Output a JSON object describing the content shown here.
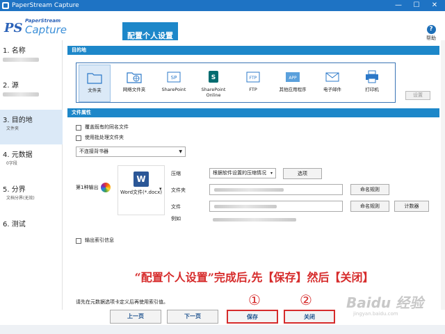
{
  "window": {
    "title": "PaperStream Capture",
    "minimize": "—",
    "maximize": "☐",
    "close": "✕"
  },
  "logo": {
    "small": "PaperStream",
    "big": "Capture"
  },
  "header": {
    "tab": "配置个人设置",
    "help_label": "帮助"
  },
  "sidebar": [
    {
      "num": "1. 名称",
      "sub": ""
    },
    {
      "num": "2. 源",
      "sub": ""
    },
    {
      "num": "3. 目的地",
      "sub": "文件夹"
    },
    {
      "num": "4. 元数据",
      "sub": "0字段"
    },
    {
      "num": "5. 分界",
      "sub": "文档分界(无效)"
    },
    {
      "num": "6. 测试",
      "sub": ""
    }
  ],
  "destination": {
    "section": "目的地",
    "items": [
      {
        "label": "文件夹",
        "icon": "folder-icon"
      },
      {
        "label": "网络文件夹",
        "icon": "network-folder-icon"
      },
      {
        "label": "SharePoint",
        "icon": "sharepoint-icon"
      },
      {
        "label": "SharePoint Online",
        "icon": "sharepoint-online-icon"
      },
      {
        "label": "FTP",
        "icon": "ftp-icon"
      },
      {
        "label": "其他应用程序",
        "icon": "app-icon"
      },
      {
        "label": "电子邮件",
        "icon": "email-icon"
      },
      {
        "label": "打印机",
        "icon": "printer-icon"
      }
    ],
    "settings_button": "设置"
  },
  "file_props": {
    "section": "文件属性",
    "overwrite": "覆盖既有的同名文件",
    "batch_folder": "使用批处理文件夹",
    "background_select": "不连接背书器",
    "output_label": "第1种输出",
    "format_label": "Word文件(*.docx)",
    "compress_label": "压缩",
    "compress_value": "根据软件设置的压缩情况",
    "options_button": "选项",
    "folder_label": "文件夹",
    "naming_button": "命名规则",
    "file_label": "文件",
    "naming_button2": "命名规则",
    "counter_button": "计数器",
    "example_label": "例如",
    "index_output": "输出索引信息"
  },
  "annotation": "“配置个人设置”完成后,先【保存】然后【关闭】",
  "note": "请先在元数据选项卡定义后再使用索引值。",
  "markers": {
    "one": "①",
    "two": "②"
  },
  "buttons": {
    "prev": "上一页",
    "next": "下一页",
    "save": "保存",
    "close": "关闭"
  },
  "watermark": {
    "brand": "Baidu 经验",
    "url": "jingyan.baidu.com"
  }
}
